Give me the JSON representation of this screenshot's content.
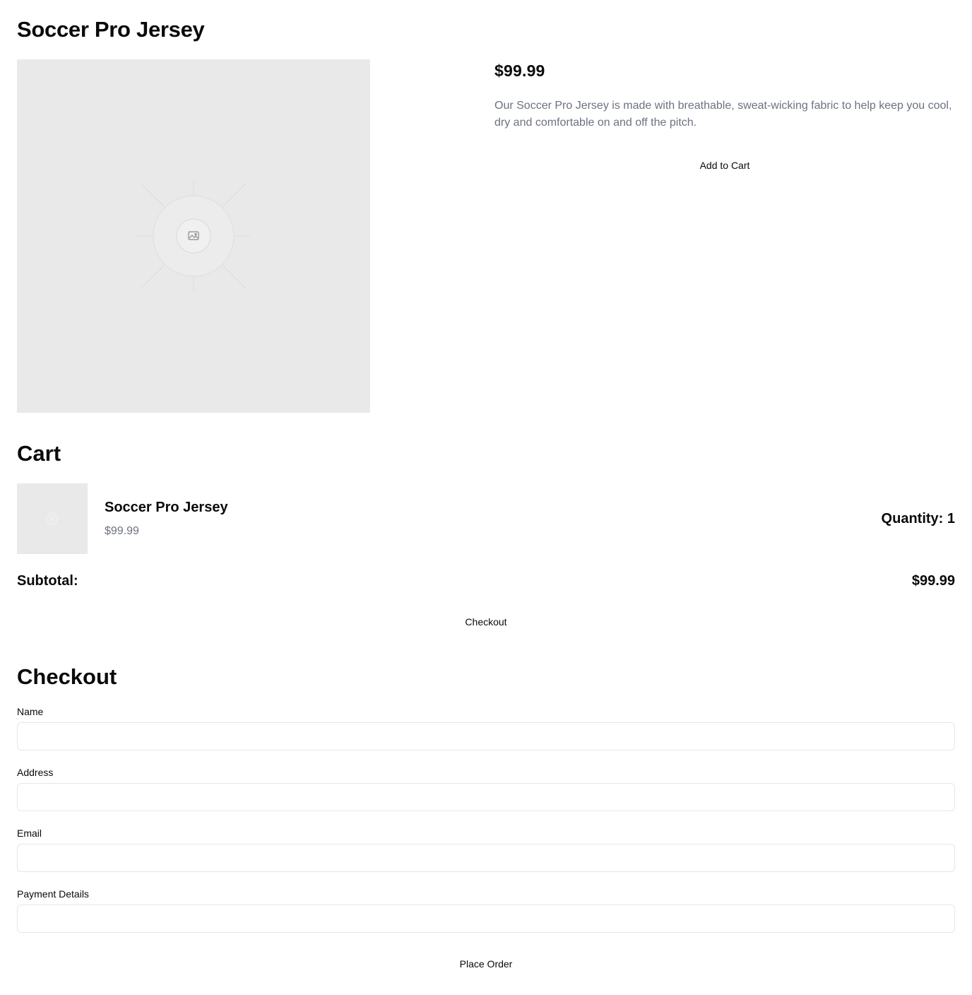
{
  "product": {
    "title": "Soccer Pro Jersey",
    "price": "$99.99",
    "description": "Our Soccer Pro Jersey is made with breathable, sweat-wicking fabric to help keep you cool, dry and comfortable on and off the pitch.",
    "add_to_cart_label": "Add to Cart",
    "image_icon": "image-placeholder-icon"
  },
  "cart": {
    "title": "Cart",
    "items": [
      {
        "name": "Soccer Pro Jersey",
        "price": "$99.99",
        "quantity_text": "Quantity: 1"
      }
    ],
    "subtotal_label": "Subtotal:",
    "subtotal_value": "$99.99",
    "checkout_label": "Checkout"
  },
  "checkout": {
    "title": "Checkout",
    "fields": [
      {
        "label": "Name",
        "value": ""
      },
      {
        "label": "Address",
        "value": ""
      },
      {
        "label": "Email",
        "value": ""
      },
      {
        "label": "Payment Details",
        "value": ""
      }
    ],
    "place_order_label": "Place Order"
  },
  "colors": {
    "text": "#0a0a0a",
    "muted_text": "#6b7280",
    "placeholder_bg": "#e9e9e9",
    "input_border": "#e5e7eb"
  }
}
